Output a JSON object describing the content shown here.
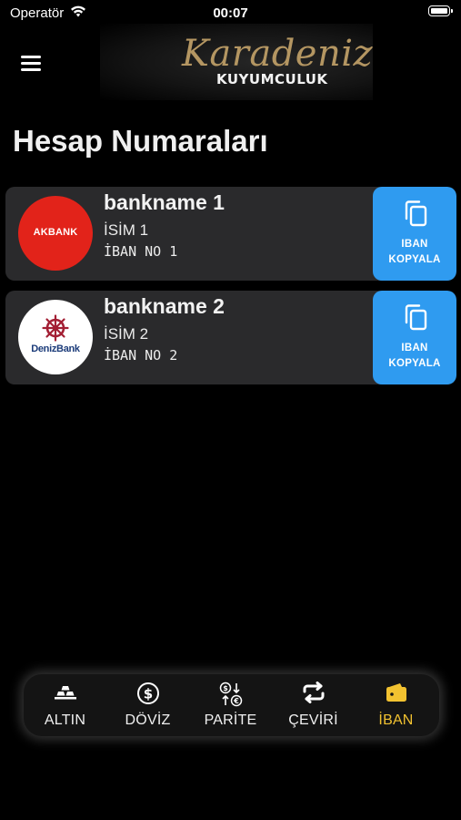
{
  "status_bar": {
    "carrier": "Operatör",
    "time": "00:07"
  },
  "header": {
    "logo_script": "Karadeniz",
    "logo_subtitle": "KUYUMCULUK"
  },
  "page": {
    "title": "Hesap Numaraları"
  },
  "accounts": [
    {
      "bank_name": "bankname 1",
      "logo_text": "AKBANK",
      "account_name": "İSİM 1",
      "iban": "İBAN NO 1",
      "copy_label_1": "IBAN",
      "copy_label_2": "KOPYALA",
      "logo_color": "#e2231a"
    },
    {
      "bank_name": "bankname 2",
      "logo_text": "DenizBank",
      "account_name": "İSİM 2",
      "iban": "İBAN NO 2",
      "copy_label_1": "IBAN",
      "copy_label_2": "KOPYALA",
      "logo_color": "#ffffff"
    }
  ],
  "tab_bar": {
    "active": "iban",
    "tabs": [
      {
        "id": "altin",
        "label": "ALTIN",
        "icon": "gold-bars-icon"
      },
      {
        "id": "doviz",
        "label": "DÖVİZ",
        "icon": "dollar-coin-icon"
      },
      {
        "id": "parite",
        "label": "PARİTE",
        "icon": "currency-exchange-icon"
      },
      {
        "id": "ceviri",
        "label": "ÇEVİRİ",
        "icon": "repeat-arrows-icon"
      },
      {
        "id": "iban",
        "label": "İBAN",
        "icon": "wallet-icon"
      }
    ]
  },
  "colors": {
    "background": "#000000",
    "card": "#2a2a2c",
    "copy_button": "#2f9bf0",
    "active_tab": "#f2c230",
    "logo_gold": "#b49662"
  }
}
